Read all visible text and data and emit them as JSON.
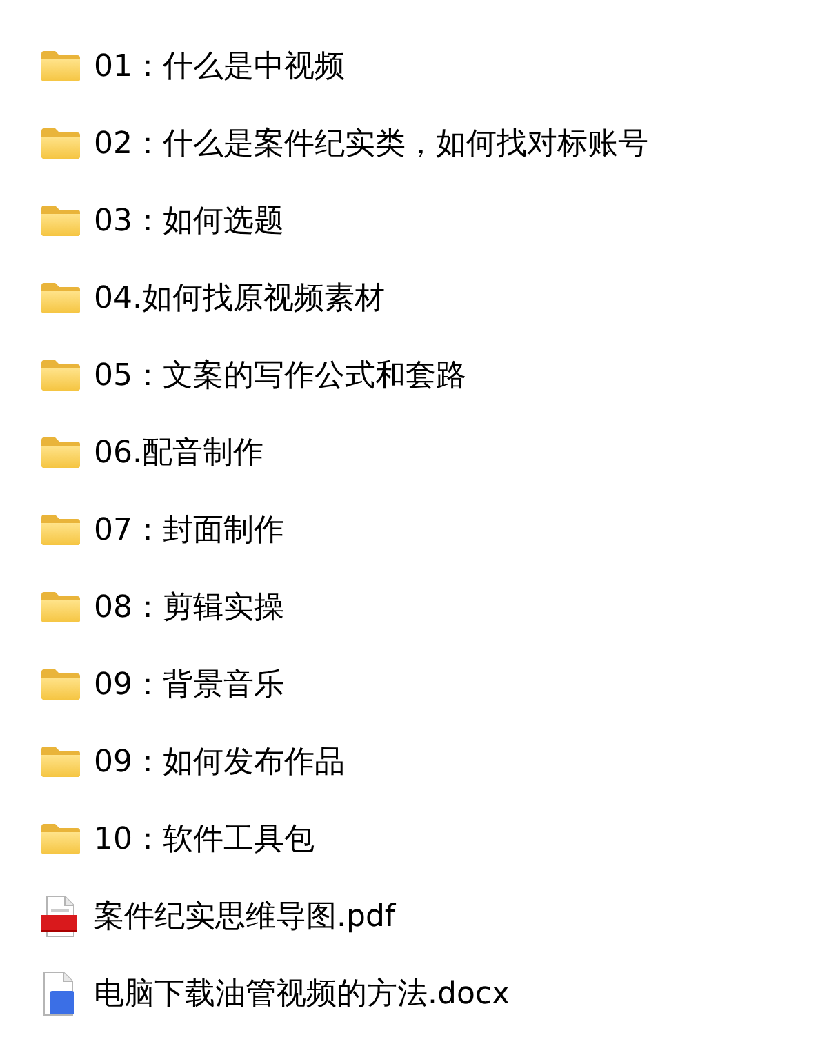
{
  "files": [
    {
      "kind": "folder",
      "name": "01：什么是中视频"
    },
    {
      "kind": "folder",
      "name": "02：什么是案件纪实类，如何找对标账号"
    },
    {
      "kind": "folder",
      "name": "03：如何选题"
    },
    {
      "kind": "folder",
      "name": "04.如何找原视频素材"
    },
    {
      "kind": "folder",
      "name": "05：文案的写作公式和套路"
    },
    {
      "kind": "folder",
      "name": "06.配音制作"
    },
    {
      "kind": "folder",
      "name": "07：封面制作"
    },
    {
      "kind": "folder",
      "name": "08：剪辑实操"
    },
    {
      "kind": "folder",
      "name": "09：背景音乐"
    },
    {
      "kind": "folder",
      "name": "09：如何发布作品"
    },
    {
      "kind": "folder",
      "name": "10：软件工具包"
    },
    {
      "kind": "pdf",
      "name": "案件纪实思维导图.pdf"
    },
    {
      "kind": "docx",
      "name": "电脑下载油管视频的方法.docx"
    }
  ]
}
